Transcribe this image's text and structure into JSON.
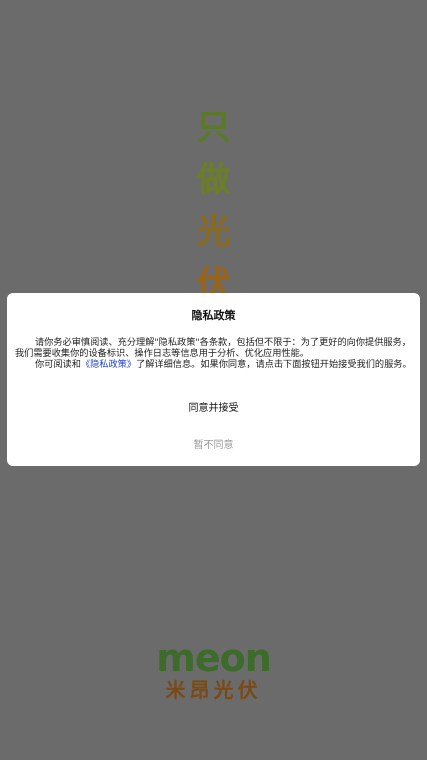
{
  "splash": {
    "slogan": [
      "只",
      "做",
      "光",
      "伏"
    ],
    "slogan_colors": [
      "#5a7a2a",
      "#6b7d26",
      "#8a6a1e",
      "#9a6418"
    ],
    "logo_text": "meon",
    "logo_cn": "米昂光伏"
  },
  "dialog": {
    "title": "隐私政策",
    "paragraph1": "请你务必审慎阅读、充分理解\"隐私政策\"各条款，包括但不限于：为了更好的向你提供服务，我们需要收集你的设备标识、操作日志等信息用于分析、优化应用性能。",
    "paragraph2_prefix": "你可阅读和",
    "paragraph2_link": "《隐私政策》",
    "paragraph2_suffix": "了解详细信息。如果你同意，请点击下面按钮开始接受我们的服务。",
    "accept_label": "同意并接受",
    "decline_label": "暂不同意"
  }
}
